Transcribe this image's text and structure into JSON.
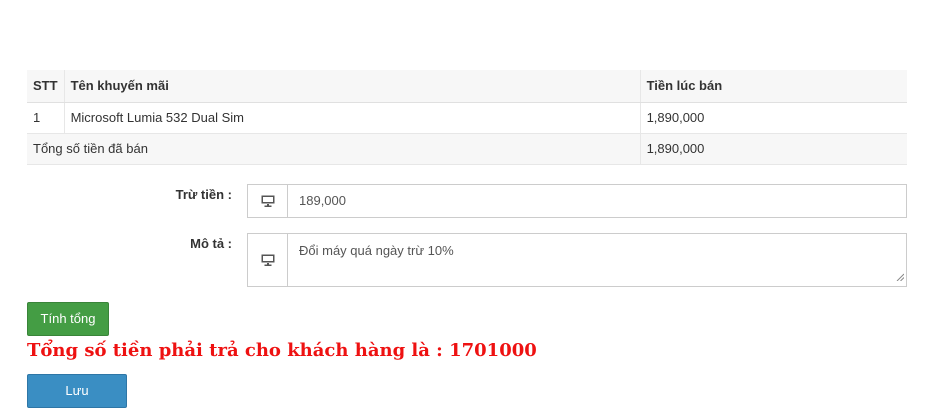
{
  "table": {
    "headers": [
      "STT",
      "Tên khuyến mãi",
      "Tiền lúc bán"
    ],
    "rows": [
      {
        "stt": "1",
        "name": "Microsoft Lumia 532 Dual Sim",
        "price": "1,890,000"
      }
    ],
    "total_label": "Tổng số tiền đã bán",
    "total_value": "1,890,000"
  },
  "form": {
    "deduct_label": "Trừ tiền :",
    "deduct_value": "189,000",
    "desc_label": "Mô tả :",
    "desc_value": "Đổi máy quá ngày trừ 10%",
    "addon_icon": "monitor-icon"
  },
  "actions": {
    "calc_label": "Tính tổng",
    "save_label": "Lưu"
  },
  "result_message": "Tổng số tiền phải trả cho khách hàng là : 1701000",
  "colors": {
    "calc_button": "#449d44",
    "save_button": "#3a8ec3",
    "result_text": "#ee1111"
  }
}
